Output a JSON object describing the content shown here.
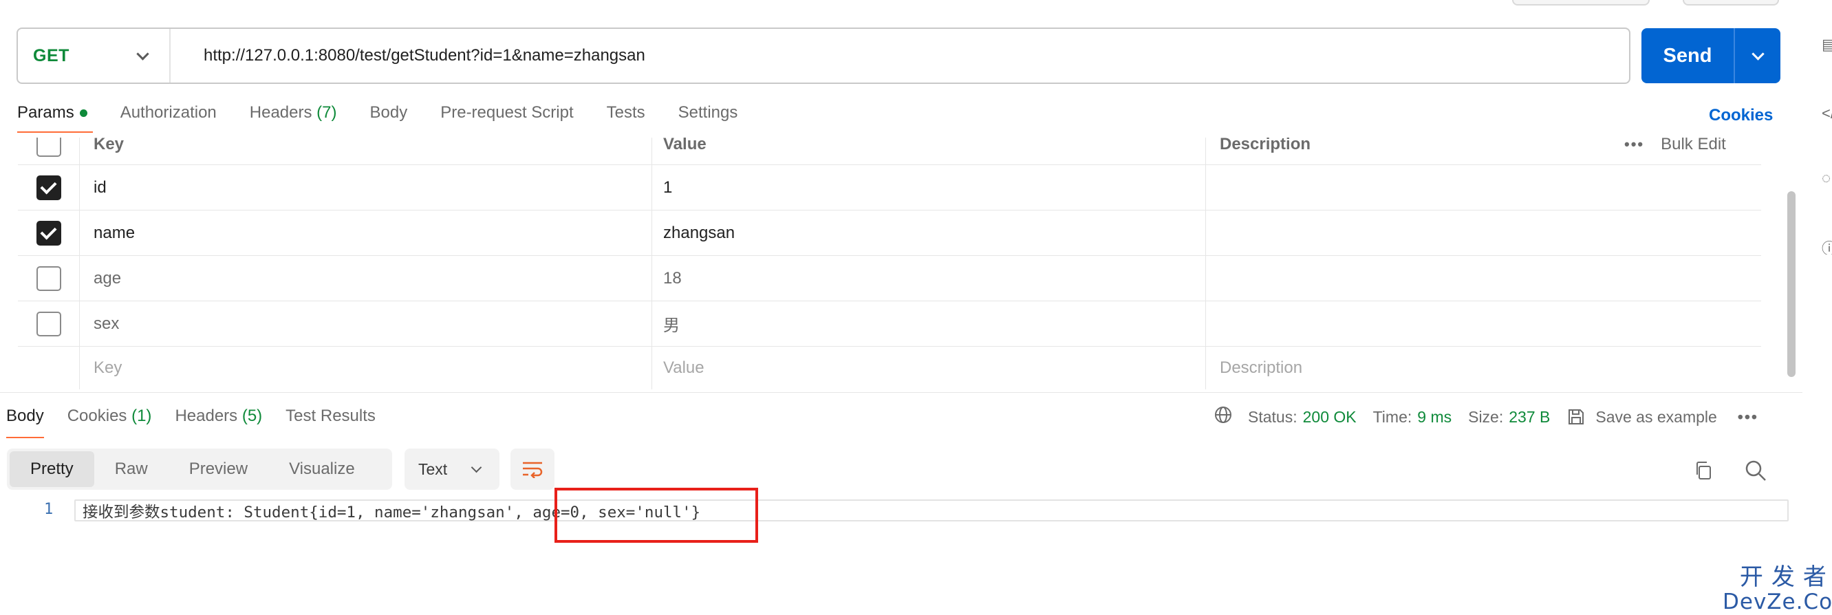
{
  "request": {
    "method": "GET",
    "url": "http://127.0.0.1:8080/test/getStudent?id=1&name=zhangsan",
    "send_label": "Send"
  },
  "request_tabs": [
    {
      "label": "Params",
      "active": true,
      "dot": true
    },
    {
      "label": "Authorization"
    },
    {
      "label": "Headers",
      "count": "(7)"
    },
    {
      "label": "Body"
    },
    {
      "label": "Pre-request Script"
    },
    {
      "label": "Tests"
    },
    {
      "label": "Settings"
    }
  ],
  "cookies_link": "Cookies",
  "params": {
    "headers": {
      "key": "Key",
      "value": "Value",
      "description": "Description",
      "bulk_edit": "Bulk Edit",
      "more": "•••"
    },
    "rows": [
      {
        "checked": true,
        "key": "id",
        "value": "1",
        "description": ""
      },
      {
        "checked": true,
        "key": "name",
        "value": "zhangsan",
        "description": ""
      },
      {
        "checked": false,
        "key": "age",
        "value": "18",
        "description": ""
      },
      {
        "checked": false,
        "key": "sex",
        "value": "男",
        "description": ""
      }
    ],
    "placeholders": {
      "key": "Key",
      "value": "Value",
      "description": "Description"
    }
  },
  "response_tabs": [
    {
      "label": "Body",
      "active": true
    },
    {
      "label": "Cookies",
      "count": "(1)"
    },
    {
      "label": "Headers",
      "count": "(5)"
    },
    {
      "label": "Test Results"
    }
  ],
  "response_status": {
    "status_label": "Status:",
    "status_value": "200 OK",
    "time_label": "Time:",
    "time_value": "9 ms",
    "size_label": "Size:",
    "size_value": "237 B",
    "save_label": "Save as example",
    "more": "•••"
  },
  "format_options": [
    "Pretty",
    "Raw",
    "Preview",
    "Visualize"
  ],
  "active_format": "Pretty",
  "language": "Text",
  "code": {
    "line_number": "1",
    "text": "接收到参数student: Student{id=1, name='zhangsan', age=0, sex='null'}"
  },
  "watermark": {
    "cn": "开发者",
    "en": "DevZe.CoM"
  },
  "colors": {
    "accent_send": "#0265d2",
    "method_get": "#0f8a3a",
    "tab_underline": "#ff6c37",
    "highlight": "#e8201a"
  }
}
